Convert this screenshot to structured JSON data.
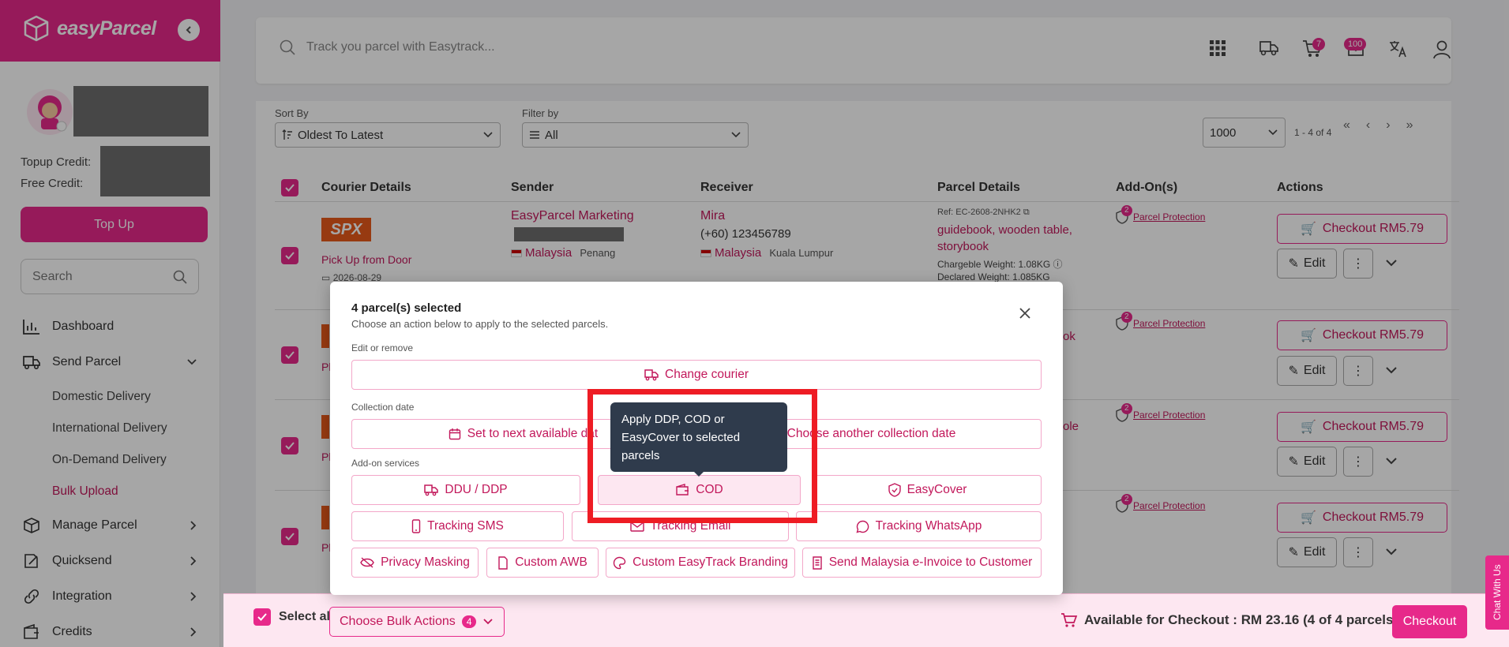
{
  "brand": {
    "name": "easyParcel"
  },
  "sidebar": {
    "credits": {
      "topup_label": "Topup Credit:",
      "free_label": "Free Credit:"
    },
    "topup_button": "Top Up",
    "search_placeholder": "Search",
    "nav": [
      {
        "label": "Dashboard",
        "icon": "bar-chart-icon"
      },
      {
        "label": "Send Parcel",
        "icon": "truck-icon",
        "expanded": true
      },
      {
        "label": "Manage Parcel",
        "icon": "box-icon"
      },
      {
        "label": "Quicksend",
        "icon": "quicksend-icon"
      },
      {
        "label": "Integration",
        "icon": "link-icon"
      },
      {
        "label": "Credits",
        "icon": "wallet-icon"
      }
    ],
    "send_parcel_sub": [
      "Domestic Delivery",
      "International Delivery",
      "On-Demand Delivery",
      "Bulk Upload"
    ],
    "active_sub": "Bulk Upload"
  },
  "topbar": {
    "track_placeholder": "Track you parcel with Easytrack...",
    "cart_badge": "7",
    "notif_badge": "100"
  },
  "controls": {
    "sort_label": "Sort By",
    "sort_value": "Oldest To Latest",
    "filter_label": "Filter by",
    "filter_value": "All",
    "page_size": "1000",
    "range": "1 - 4 of 4"
  },
  "table": {
    "headers": [
      "Courier Details",
      "Sender",
      "Receiver",
      "Parcel Details",
      "Add-On(s)",
      "Actions"
    ],
    "row1": {
      "courier_logo": "SPX",
      "pickup": "Pick Up from Door",
      "date": "2026-08-29",
      "sender_name": "EasyParcel Marketing",
      "sender_country": "Malaysia",
      "sender_state": "Penang",
      "receiver_name": "Mira",
      "receiver_phone": "(+60) 123456789",
      "receiver_country": "Malaysia",
      "receiver_state": "Kuala Lumpur",
      "ref": "Ref: EC-2608-2NHK2",
      "items": "guidebook, wooden table, storybook",
      "chargeable": "Chargeble Weight: 1.08KG",
      "declared": "Declared Weight: 1.085KG"
    },
    "row_fragments": {
      "pl": "Pl",
      "ok": "ok",
      "ole": "ole"
    },
    "addon_label": "Parcel Protection",
    "addon_badge": "2",
    "checkout_label": "Checkout RM5.79",
    "edit_label": "Edit"
  },
  "modal": {
    "title": "4 parcel(s) selected",
    "subtitle": "Choose an action below to apply to the selected parcels.",
    "sections": {
      "edit": "Edit or remove",
      "collection": "Collection date",
      "addon": "Add-on services"
    },
    "buttons": {
      "change_courier": "Change courier",
      "next_date": "Set to next available dat",
      "other_date": "Choose another collection date",
      "ddu": "DDU / DDP",
      "cod": "COD",
      "easycover": "EasyCover",
      "sms": "Tracking SMS",
      "email": "Tracking Email",
      "whatsapp": "Tracking WhatsApp",
      "privacy": "Privacy Masking",
      "awb": "Custom AWB",
      "branding": "Custom EasyTrack Branding",
      "einvoice": "Send Malaysia e-Invoice to Customer"
    },
    "tooltip": "Apply DDP, COD or EasyCover to selected parcels"
  },
  "bottombar": {
    "select_all": "Select all",
    "bulk_label": "Choose Bulk Actions",
    "bulk_count": "4",
    "available": "Available for Checkout : RM 23.16 (4 of 4 parcels)",
    "checkout": "Checkout"
  },
  "chat_tab": "Chat With Us",
  "colors": {
    "brand": "#e7298a",
    "accent_text": "#c2185b",
    "highlight": "#ee1c24"
  }
}
